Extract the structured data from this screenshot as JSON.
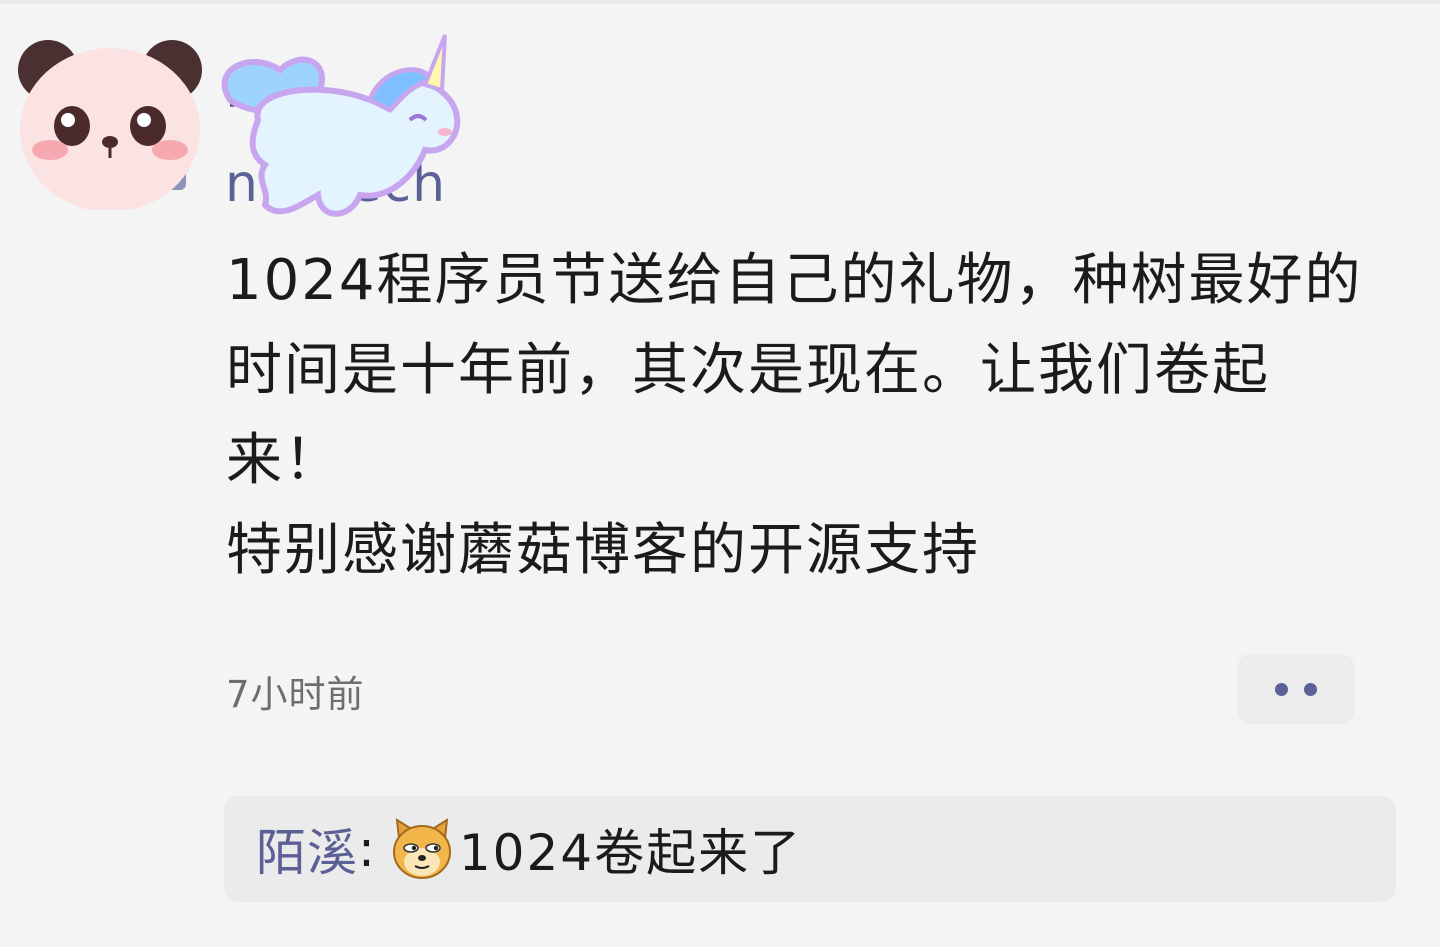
{
  "comment": {
    "author_name_line1": "levi",
    "author_name_line2": "nm tech",
    "text_paragraph1": "1024程序员节送给自己的礼物，种树最好的时间是十年前，其次是现在。让我们卷起来！",
    "text_paragraph2": "特别感谢蘑菇博客的开源支持",
    "timestamp": "7小时前",
    "avatar_icon": "panda-avatar",
    "decoration_icon": "unicorn-sticker",
    "more_icon": "more-dots-icon"
  },
  "reply": {
    "author": "陌溪",
    "separator": ":",
    "emoji_icon": "doge-emoji",
    "text": "1024卷起来了"
  },
  "colors": {
    "background": "#f4f4f4",
    "author_link": "#5b6096",
    "text": "#1b1b1b",
    "muted": "#6e6e6e",
    "reply_bg": "#ebebeb"
  }
}
